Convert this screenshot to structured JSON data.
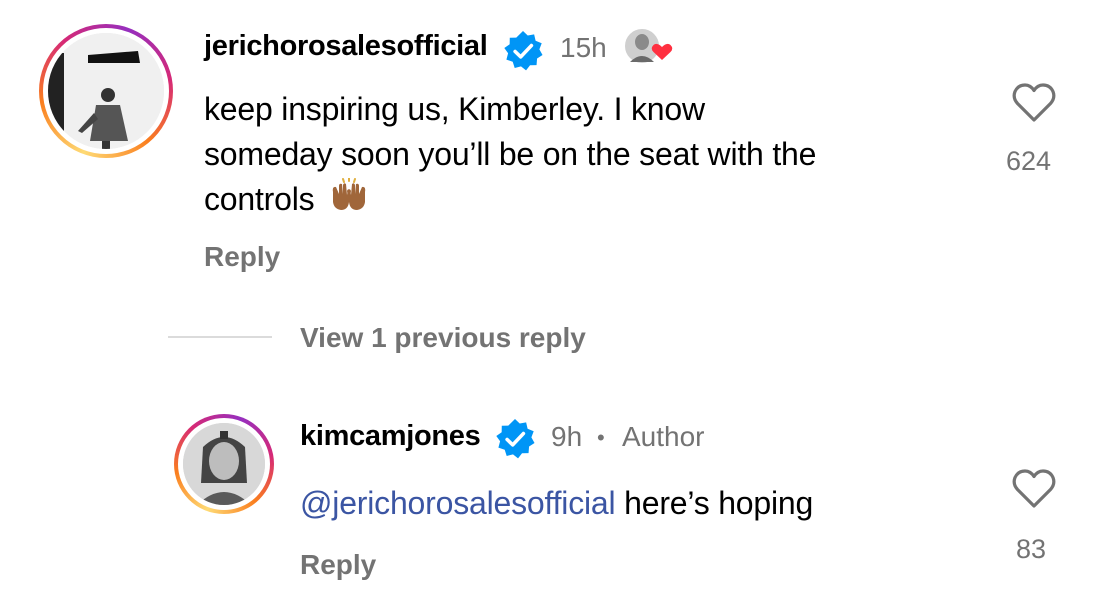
{
  "comments": [
    {
      "username": "jerichorosalesofficial",
      "time": "15h",
      "text": "keep inspiring us, Kimberley. I know someday soon you'll be on the seat with the controls 🙌🏽",
      "text_lines": [
        "keep inspiring us, Kimberley. I know",
        "someday soon you’ll be on the seat with the",
        "controls"
      ],
      "emoji": "🙌🏽",
      "reply_label": "Reply",
      "likes": "624",
      "icons": {
        "verified": "verified-badge-icon",
        "like": "heart-outline-icon",
        "liked_by_author": "author-liked-avatar-heart-icon"
      }
    },
    {
      "username": "kimcamjones",
      "time": "9h",
      "separator": "•",
      "author_label": "Author",
      "mention": "@jerichorosalesofficial",
      "text": "here’s hoping",
      "reply_label": "Reply",
      "likes": "83",
      "icons": {
        "verified": "verified-badge-icon",
        "like": "heart-outline-icon"
      }
    }
  ],
  "thread": {
    "view_previous": "View 1 previous reply"
  },
  "colors": {
    "verified": "#0095f6",
    "mention": "#3b55a3",
    "secondary": "#737373",
    "divider": "#dbdbdb"
  }
}
